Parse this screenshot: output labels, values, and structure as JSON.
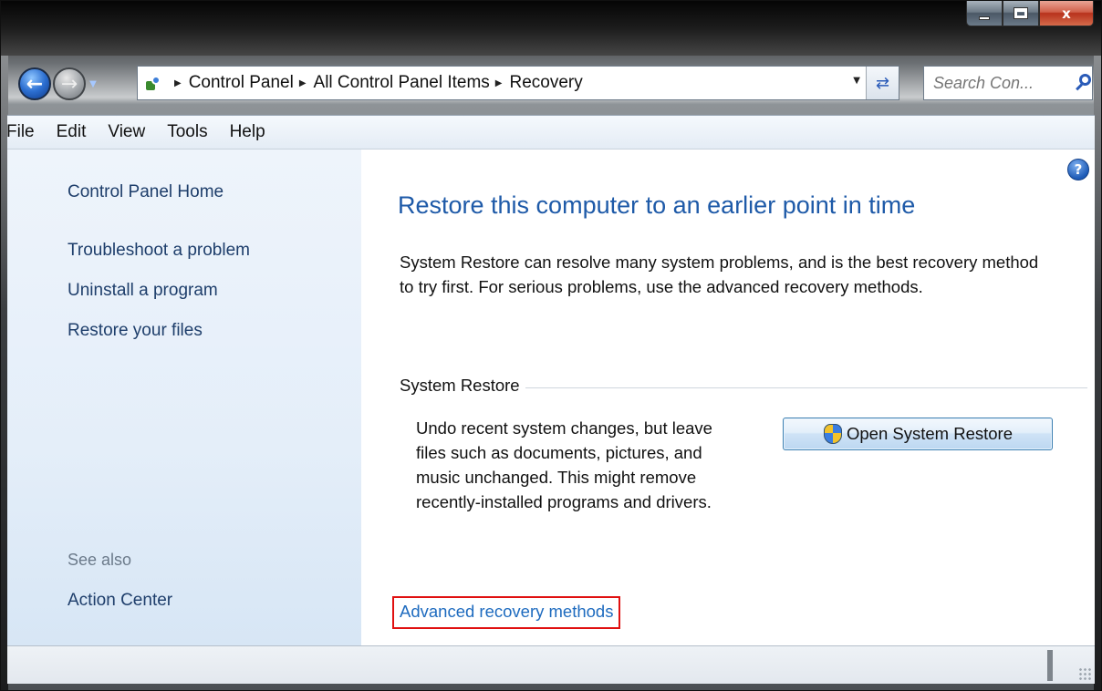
{
  "window": {
    "caption_buttons": {
      "minimize_icon": "minimize-icon",
      "maximize_icon": "maximize-icon",
      "close_label": "x"
    }
  },
  "nav": {
    "back_icon": "back-arrow-icon",
    "forward_icon": "forward-arrow-icon",
    "breadcrumb": [
      "Control Panel",
      "All Control Panel Items",
      "Recovery"
    ],
    "search_placeholder": "Search Con...",
    "refresh_icon": "refresh-icon"
  },
  "menubar": {
    "items": [
      "File",
      "Edit",
      "View",
      "Tools",
      "Help"
    ]
  },
  "sidebar": {
    "home": "Control Panel Home",
    "links": [
      "Troubleshoot a problem",
      "Uninstall a program",
      "Restore your files"
    ],
    "see_also_label": "See also",
    "see_also_links": [
      "Action Center"
    ]
  },
  "main": {
    "help_label": "?",
    "title": "Restore this computer to an earlier point in time",
    "intro": "System Restore can resolve many system problems, and is the best recovery method to try first. For serious problems, use the advanced recovery methods.",
    "section_title": "System Restore",
    "section_description": "Undo recent system changes, but leave files such as documents, pictures, and music unchanged. This might remove recently-installed programs and drivers.",
    "restore_button_label": "Open System Restore",
    "advanced_link": "Advanced recovery methods"
  },
  "colors": {
    "title_blue": "#1e5aa8",
    "link_blue": "#1e6bbf",
    "highlight_red": "#e01010"
  }
}
